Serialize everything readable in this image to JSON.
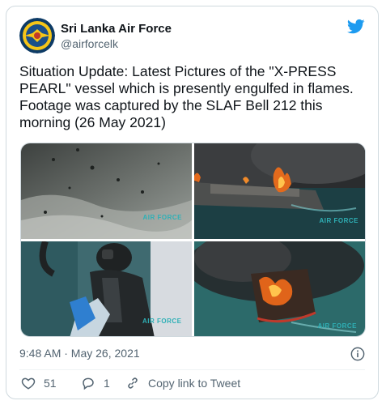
{
  "tweet": {
    "author_name": "Sri Lanka Air Force",
    "author_handle": "@airforcelk",
    "text_lines": [
      "Situation Update: Latest Pictures of the \"X-PRESS",
      "PEARL\" vessel which is presently engulfed in flames.",
      "Footage was captured by the SLAF Bell 212 this",
      "morning (26 May 2021)"
    ],
    "timestamp": "9:48 AM · May 26, 2021",
    "media": [
      {
        "name": "debris-water-photo",
        "watermark": "AIR FORCE"
      },
      {
        "name": "burning-ship-photo",
        "watermark": "AIR FORCE"
      },
      {
        "name": "helicopter-crew-photo",
        "watermark": "AIR FORCE"
      },
      {
        "name": "aerial-fire-photo",
        "watermark": "AIR FORCE"
      }
    ]
  },
  "actions": {
    "like_count": "51",
    "reply_count": "1",
    "copy_link_label": "Copy link to Tweet"
  },
  "colors": {
    "brand_blue": "#1d9bf0",
    "text_secondary": "#536471",
    "border": "#cfd9de"
  },
  "icons": [
    "air-force-logo-avatar",
    "twitter-bird-icon",
    "info-icon",
    "heart-icon",
    "reply-icon",
    "link-icon"
  ]
}
